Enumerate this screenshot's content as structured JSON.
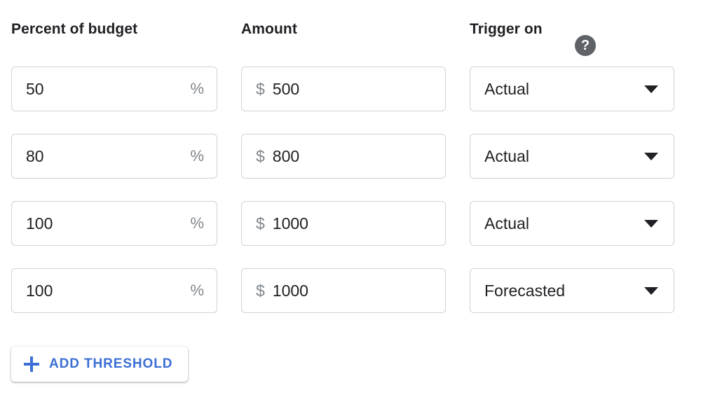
{
  "columns": {
    "percent_label": "Percent of budget",
    "amount_label": "Amount",
    "trigger_label": "Trigger on",
    "help_icon_glyph": "?"
  },
  "units": {
    "percent_suffix": "%",
    "currency_prefix": "$"
  },
  "rows": [
    {
      "percent": "50",
      "amount": "500",
      "trigger": "Actual"
    },
    {
      "percent": "80",
      "amount": "800",
      "trigger": "Actual"
    },
    {
      "percent": "100",
      "amount": "1000",
      "trigger": "Actual"
    },
    {
      "percent": "100",
      "amount": "1000",
      "trigger": "Forecasted"
    }
  ],
  "trigger_options": [
    "Actual",
    "Forecasted"
  ],
  "add_button": {
    "label": "ADD THRESHOLD",
    "icon": "plus-icon"
  },
  "colors": {
    "accent_blue": "#3b6fd4",
    "text_primary": "#202124",
    "text_muted": "#80868b",
    "field_border": "#d2d2d2",
    "help_icon_bg": "#5f6368"
  }
}
